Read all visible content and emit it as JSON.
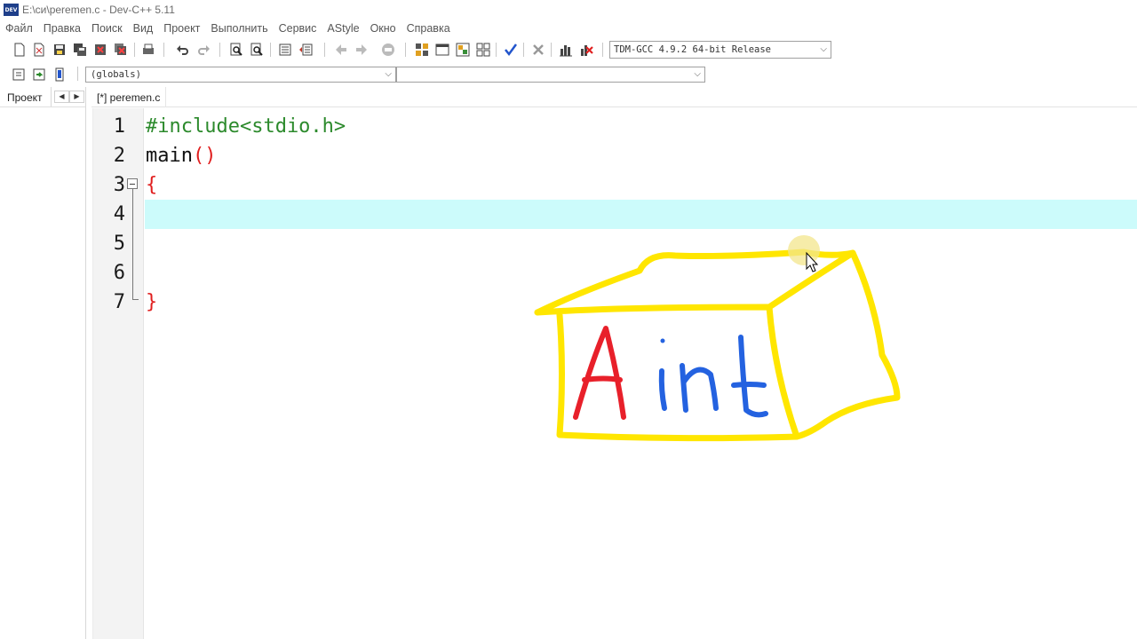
{
  "window": {
    "title": "E:\\си\\peremen.c - Dev-C++ 5.11",
    "icon_label": "DEV"
  },
  "menu": [
    "Файл",
    "Правка",
    "Поиск",
    "Вид",
    "Проект",
    "Выполнить",
    "Сервис",
    "AStyle",
    "Окно",
    "Справка"
  ],
  "toolbar": {
    "icons": [
      "new-file-icon",
      "open-icon",
      "save-icon",
      "save-all-icon",
      "close-icon",
      "close-all-icon",
      "print-icon",
      "undo-icon",
      "redo-icon",
      "find-icon",
      "replace-icon",
      "indent-icon",
      "unindent-icon",
      "back-icon",
      "forward-icon",
      "goto-icon",
      "project-icon",
      "window-icon",
      "class-browser-icon",
      "grid-icon",
      "check-syntax-icon",
      "delete-icon",
      "chart-icon",
      "profile-icon"
    ],
    "compiler": "TDM-GCC 4.9.2 64-bit Release"
  },
  "toolbar2": {
    "scope": "(globals)",
    "function": ""
  },
  "left_panel": {
    "tab": "Проект",
    "prev": "◀",
    "next": "▶"
  },
  "file_tab": "[*] peremen.c",
  "editor": {
    "line_numbers": [
      "1",
      "2",
      "3",
      "4",
      "5",
      "6",
      "7"
    ],
    "lines": [
      {
        "parts": [
          {
            "text": "#include<stdio.h>",
            "cls": "kw-pre"
          }
        ]
      },
      {
        "parts": [
          {
            "text": "main",
            "cls": "plain"
          },
          {
            "text": "()",
            "cls": "brace"
          }
        ]
      },
      {
        "parts": [
          {
            "text": "{",
            "cls": "brace"
          }
        ]
      },
      {
        "parts": []
      },
      {
        "parts": []
      },
      {
        "parts": []
      },
      {
        "parts": [
          {
            "text": "}",
            "cls": "brace"
          }
        ]
      }
    ],
    "active_line": 4
  },
  "drawing": {
    "letter_red": "A",
    "letters_blue": "int",
    "box_color": "#ffe600",
    "red_color": "#e8202a",
    "blue_color": "#2462e0"
  },
  "colors": {
    "active_line": "#ccfbfb",
    "preprocessor": "#2c8a2c",
    "brace": "#e01e1e"
  }
}
